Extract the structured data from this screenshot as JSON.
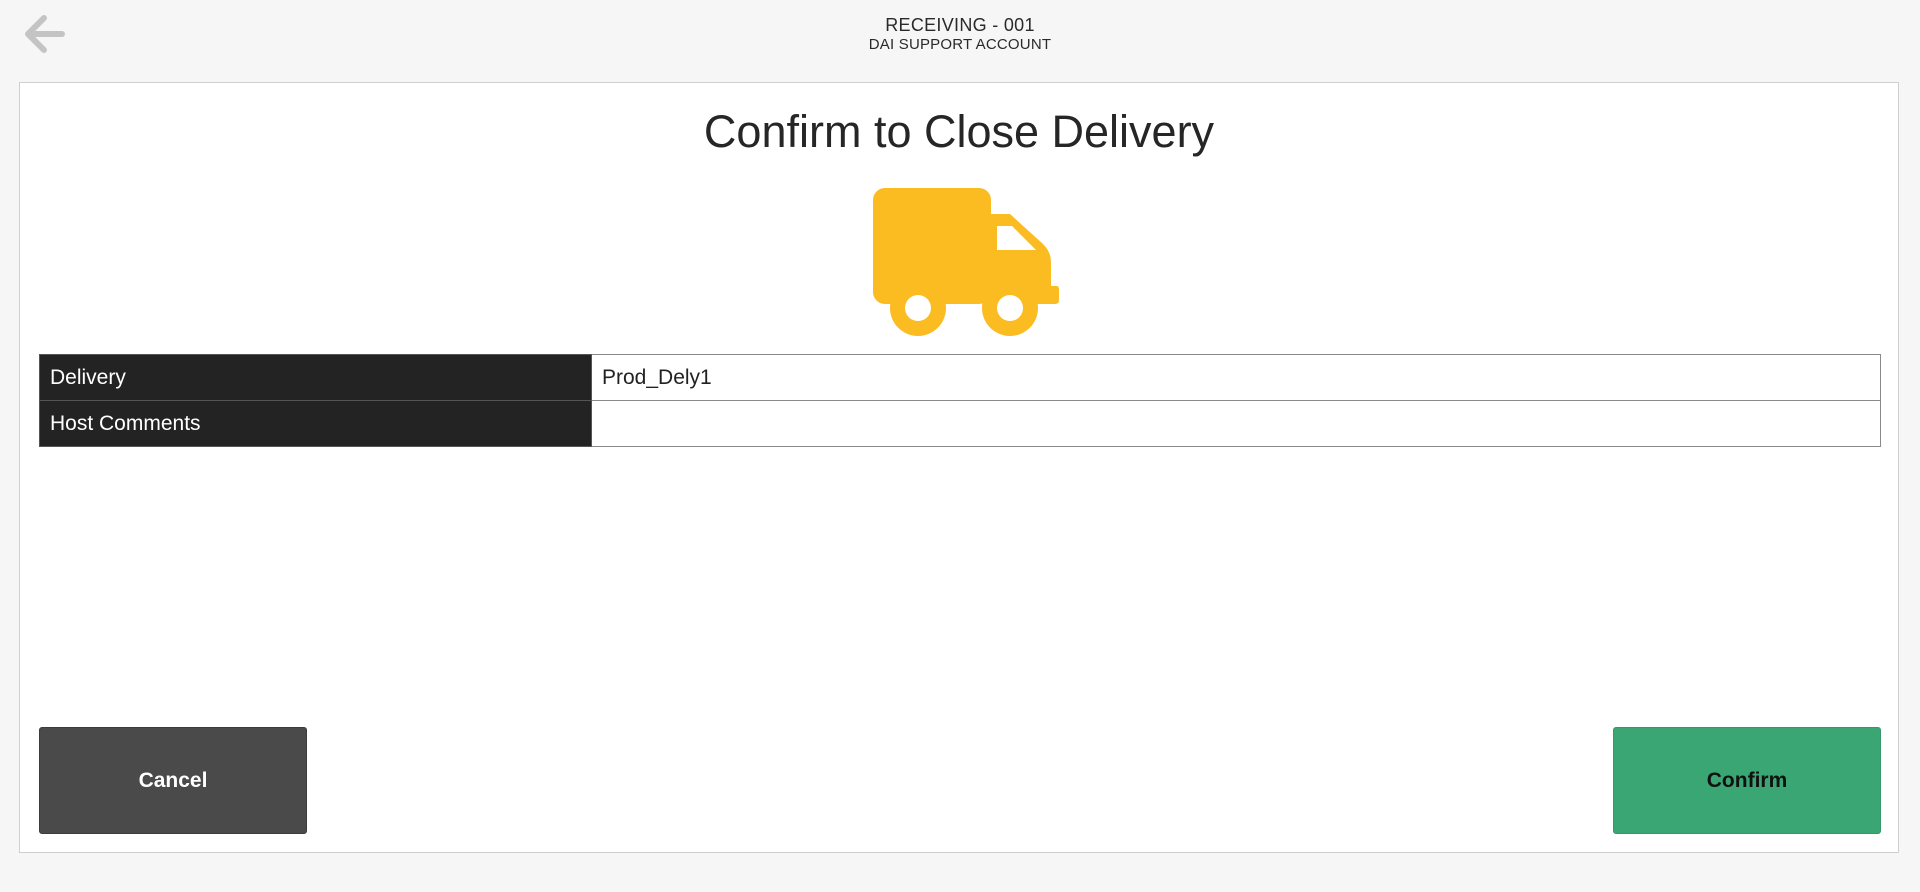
{
  "header": {
    "title": "RECEIVING - 001",
    "subtitle": "DAI SUPPORT ACCOUNT",
    "back_icon": "arrow-left-icon"
  },
  "dialog": {
    "title": "Confirm to Close Delivery",
    "icon": "truck-icon",
    "icon_color": "#FBBC22",
    "rows": [
      {
        "label": "Delivery",
        "value": "Prod_Dely1"
      },
      {
        "label": "Host Comments",
        "value": ""
      }
    ]
  },
  "buttons": {
    "cancel_label": "Cancel",
    "confirm_label": "Confirm",
    "cancel_color": "#4A4A4A",
    "confirm_color": "#3AA673"
  }
}
